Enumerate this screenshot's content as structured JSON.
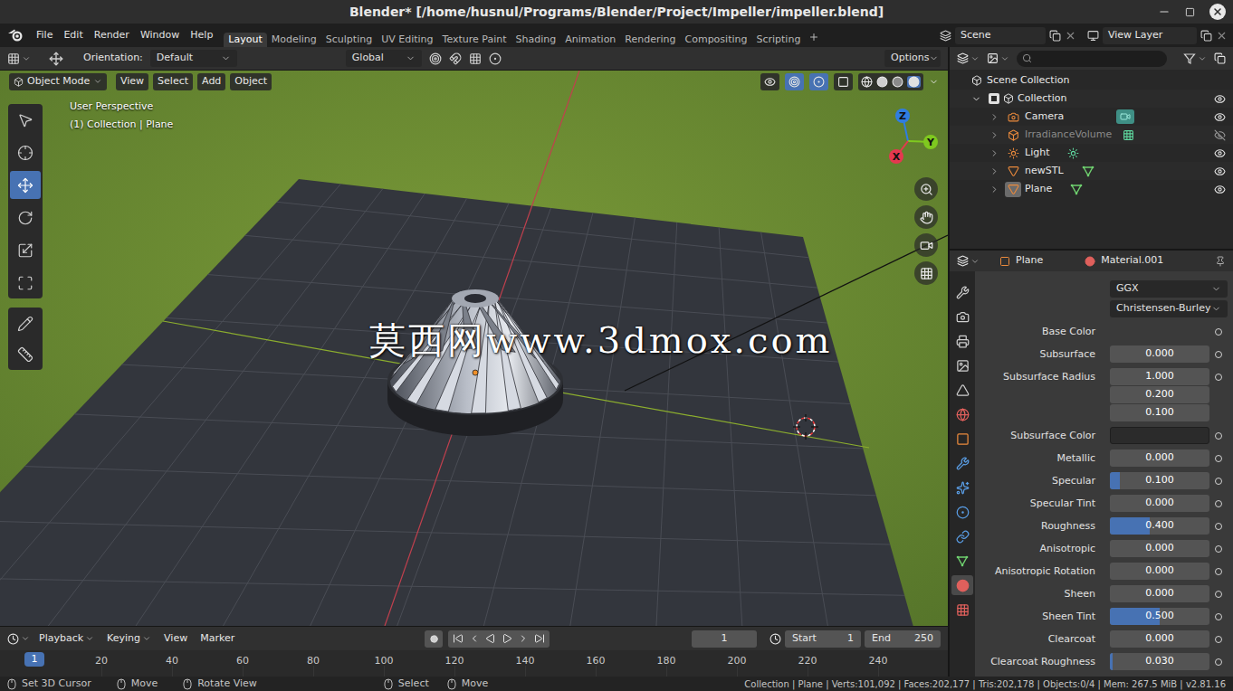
{
  "window": {
    "title": "Blender* [/home/husnul/Programs/Blender/Project/Impeller/impeller.blend]"
  },
  "menu": [
    "File",
    "Edit",
    "Render",
    "Window",
    "Help"
  ],
  "workspaces": [
    {
      "label": "Layout",
      "selected": true
    },
    {
      "label": "Modeling",
      "selected": false
    },
    {
      "label": "Sculpting",
      "selected": false
    },
    {
      "label": "UV Editing",
      "selected": false
    },
    {
      "label": "Texture Paint",
      "selected": false
    },
    {
      "label": "Shading",
      "selected": false
    },
    {
      "label": "Animation",
      "selected": false
    },
    {
      "label": "Rendering",
      "selected": false
    },
    {
      "label": "Compositing",
      "selected": false
    },
    {
      "label": "Scripting",
      "selected": false
    }
  ],
  "scene": "Scene",
  "view_layer": "View Layer",
  "tool_header": {
    "orientation_label": "Orientation:",
    "orientation": "Default",
    "transform": "Global",
    "options": "Options"
  },
  "viewport": {
    "mode": "Object Mode",
    "menus": [
      "View",
      "Select",
      "Add",
      "Object"
    ],
    "overlay": [
      "User Perspective",
      "(1) Collection | Plane"
    ],
    "axes": [
      {
        "label": "Z",
        "color": "#2f7de1"
      },
      {
        "label": "Y",
        "color": "#7fc91f"
      },
      {
        "label": "X",
        "color": "#e5384f"
      }
    ],
    "tools": [
      {
        "kind": "select",
        "selected": false
      },
      {
        "kind": "cursor",
        "selected": false
      },
      {
        "kind": "move",
        "selected": true
      },
      {
        "kind": "rotate",
        "selected": false
      },
      {
        "kind": "scale",
        "selected": false
      },
      {
        "kind": "transform",
        "selected": false
      },
      {
        "kind": "annotate",
        "selected": false
      },
      {
        "kind": "measure",
        "selected": false
      }
    ]
  },
  "watermark": "莫西网www.3dmox.com",
  "outliner": {
    "root": "Scene Collection",
    "collections": [
      {
        "name": "Collection",
        "expanded": true,
        "checked": true,
        "visible": true,
        "children": [
          {
            "name": "Camera",
            "kind": "camera",
            "expanded": false,
            "visible": true,
            "active": false
          },
          {
            "name": "IrradianceVolume",
            "kind": "probe",
            "expanded": false,
            "visible": false,
            "active": false
          },
          {
            "name": "Light",
            "kind": "light",
            "expanded": false,
            "visible": true,
            "active": false
          },
          {
            "name": "newSTL",
            "kind": "mesh",
            "expanded": false,
            "visible": true,
            "active": false
          },
          {
            "name": "Plane",
            "kind": "mesh",
            "expanded": false,
            "visible": true,
            "active": true
          }
        ]
      }
    ]
  },
  "properties": {
    "object": "Plane",
    "material": "Material.001",
    "tabs": [
      {
        "kind": "tool",
        "selected": false
      },
      {
        "kind": "render",
        "selected": false
      },
      {
        "kind": "output",
        "selected": false
      },
      {
        "kind": "view_layer",
        "selected": false
      },
      {
        "kind": "scene",
        "selected": false
      },
      {
        "kind": "world",
        "selected": false
      },
      {
        "kind": "object",
        "selected": false
      },
      {
        "kind": "modifiers",
        "selected": false
      },
      {
        "kind": "particles",
        "selected": false
      },
      {
        "kind": "physics",
        "selected": false
      },
      {
        "kind": "constraints",
        "selected": false
      },
      {
        "kind": "data",
        "selected": false
      },
      {
        "kind": "material",
        "selected": true
      },
      {
        "kind": "texture",
        "selected": false
      }
    ],
    "dropdowns": [
      "GGX",
      "Christensen-Burley"
    ],
    "rows": [
      {
        "kind": "socket",
        "label": "Base Color"
      },
      {
        "kind": "slider",
        "label": "Subsurface",
        "value": "0.000",
        "level": 0
      },
      {
        "kind": "vector",
        "label": "Subsurface Radius",
        "values": [
          "1.000",
          "0.200",
          "0.100"
        ]
      },
      {
        "kind": "color",
        "label": "Subsurface Color",
        "color": "#2b2b2b"
      },
      {
        "kind": "slider",
        "label": "Metallic",
        "value": "0.000",
        "level": 0
      },
      {
        "kind": "slider",
        "label": "Specular",
        "value": "0.100",
        "level": 0.1
      },
      {
        "kind": "slider",
        "label": "Specular Tint",
        "value": "0.000",
        "level": 0
      },
      {
        "kind": "slider",
        "label": "Roughness",
        "value": "0.400",
        "level": 0.4
      },
      {
        "kind": "slider",
        "label": "Anisotropic",
        "value": "0.000",
        "level": 0
      },
      {
        "kind": "slider",
        "label": "Anisotropic Rotation",
        "value": "0.000",
        "level": 0
      },
      {
        "kind": "slider",
        "label": "Sheen",
        "value": "0.000",
        "level": 0
      },
      {
        "kind": "slider",
        "label": "Sheen Tint",
        "value": "0.500",
        "level": 0.5
      },
      {
        "kind": "slider",
        "label": "Clearcoat",
        "value": "0.000",
        "level": 0
      },
      {
        "kind": "slider",
        "label": "Clearcoat Roughness",
        "value": "0.030",
        "level": 0.03
      }
    ]
  },
  "timeline": {
    "menus": [
      "Playback",
      "Keying",
      "View",
      "Marker"
    ],
    "frame": "1",
    "start_label": "Start",
    "start": "1",
    "end_label": "End",
    "end": "250",
    "playhead": "1",
    "ticks": [
      "20",
      "40",
      "60",
      "80",
      "100",
      "120",
      "140",
      "160",
      "180",
      "200",
      "220",
      "240"
    ]
  },
  "status_bar": {
    "hints_left": [
      "Set 3D Cursor",
      "Move",
      "Rotate View"
    ],
    "hints_center": [
      "Select",
      "Move"
    ],
    "stats": "Collection | Plane | Verts:101,092 | Faces:202,177 | Tris:202,178 | Objects:0/4 | Mem: 267.5 MiB | v2.81.16"
  }
}
